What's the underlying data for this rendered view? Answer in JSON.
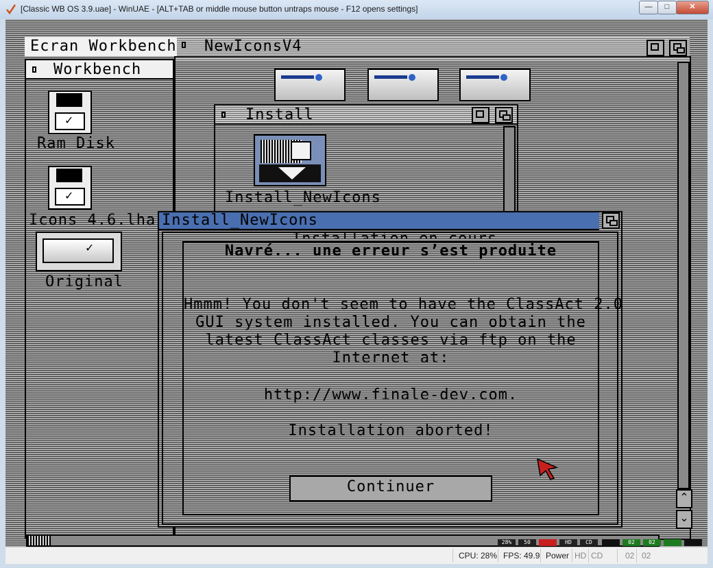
{
  "host": {
    "title": "[Classic WB OS 3.9.uae] - WinUAE - [ALT+TAB or middle mouse button untraps mouse - F12 opens settings]",
    "status": {
      "cpu": "CPU: 28%",
      "fps": "FPS: 49.9",
      "power": "Power",
      "hd": "HD",
      "cd": "CD",
      "df0": "02",
      "df1": "02"
    },
    "leds": {
      "cpu": "28%",
      "fps": "50",
      "hd": "HD",
      "cd": "CD",
      "df0": "02",
      "df1": "02"
    }
  },
  "screen": {
    "title": "Ecran Workbench",
    "workbench_window": {
      "title": "Workbench"
    },
    "newicons_window": {
      "title": "NewIconsV4"
    },
    "install_window": {
      "title": "Install"
    },
    "icons": {
      "ram_disk": "Ram Disk",
      "icons_lha": "Icons 4.6.lha",
      "original": "Original",
      "install_newicons": "Install_NewIcons"
    },
    "dialog": {
      "window_title": "Install_NewIcons",
      "behind_text": "Installation en cours",
      "heading": "Navré... une erreur s’est produite",
      "lines": [
        "Hmmm!  You don't seem to have the ClassAct 2.0",
        "GUI system installed.  You can obtain the",
        "latest ClassAct classes via ftp on the",
        "Internet at:"
      ],
      "url": "http://www.finale-dev.com.",
      "aborted": "Installation aborted!",
      "button": "Continuer"
    }
  },
  "colors": {
    "amiga_blue": "#4a6fb0",
    "led_red": "#c81e1e",
    "led_green": "#1e7a1e"
  }
}
